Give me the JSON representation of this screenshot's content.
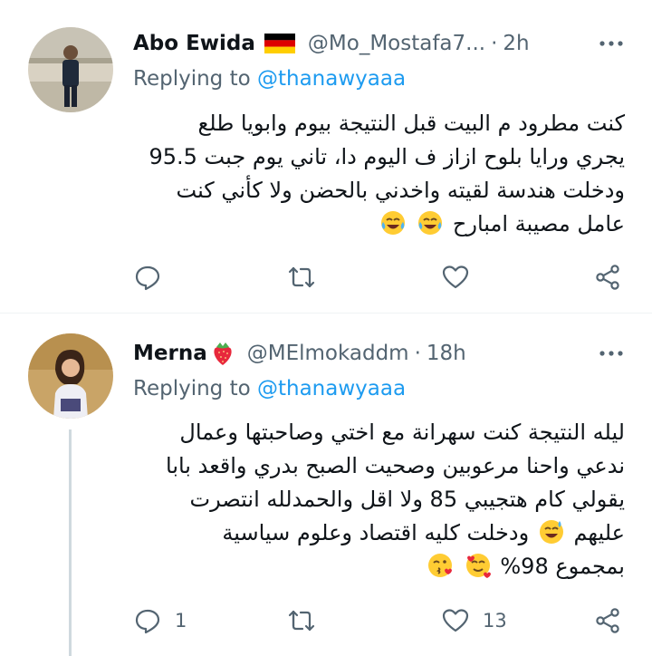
{
  "tweets": [
    {
      "name": "Abo Ewida",
      "handle": "@Mo_Mostafa7...",
      "time": "2h",
      "replying_prefix": "Replying to",
      "replying_to": "@thanawyaaa",
      "body_lines": [
        "كنت مطرود م البيت قبل النتيجة بيوم وابويا طلع",
        "يجري ورايا بلوح ازاز ف اليوم دا، تاني يوم جبت 95.5",
        "ودخلت هندسة لقيته واخدني بالحضن ولا كأني كنت",
        "عامل مصيبة امبارح"
      ],
      "emojis": [
        "tears-of-joy",
        "tears-of-joy"
      ],
      "actions": {
        "reply_count": "",
        "retweet_count": "",
        "like_count": ""
      }
    },
    {
      "name": "Merna",
      "name_emoji": "strawberry",
      "handle": "@MElmokaddm",
      "time": "18h",
      "replying_prefix": "Replying to",
      "replying_to": "@thanawyaaa",
      "body_lines": [
        "ليله النتيجة كنت سهرانة مع اختي وصاحبتها وعمال",
        "ندعي واحنا مرعوبين وصحيت الصبح بدري واقعد بابا",
        "يقولي كام هتجيبي 85 ولا اقل والحمدلله انتصرت",
        "عليهم",
        "ودخلت كليه اقتصاد وعلوم سياسية",
        "بمجموع 98%"
      ],
      "emojis": [
        "grinning-sweat",
        "smiling-hearts",
        "kissing-heart"
      ],
      "actions": {
        "reply_count": "1",
        "retweet_count": "",
        "like_count": "13"
      }
    }
  ],
  "colors": {
    "text": "#0f1419",
    "secondary": "#536471",
    "accent": "#1d9bf0",
    "divider": "#eff3f4"
  }
}
